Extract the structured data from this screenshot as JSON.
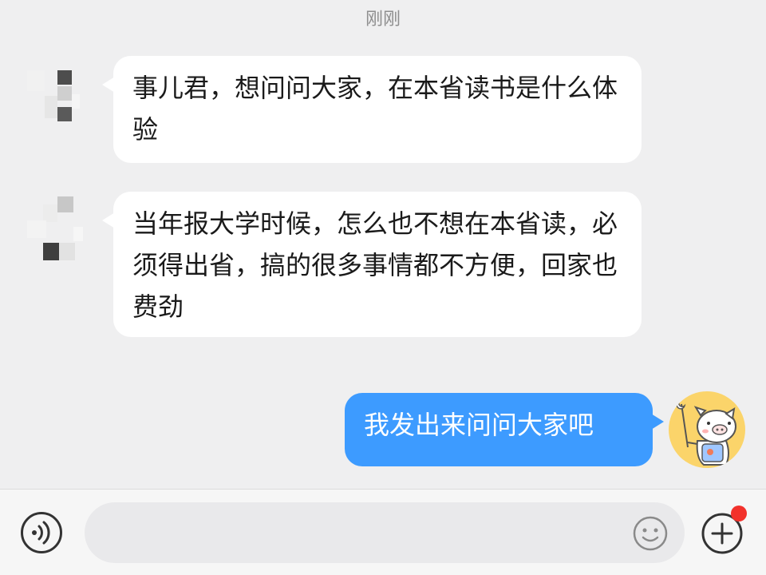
{
  "chat": {
    "timestamp": "刚刚",
    "messages": [
      {
        "side": "left",
        "text": "事儿君，想问问大家，在本省读书是什么体验"
      },
      {
        "side": "left",
        "text": "当年报大学时候，怎么也不想在本省读，必须得出省，搞的很多事情都不方便，回家也费劲"
      },
      {
        "side": "right",
        "text": "我发出来问问大家吧"
      }
    ]
  },
  "input_bar": {
    "text_value": "",
    "voice_icon": "voice-icon",
    "emoji_icon": "emoji-icon",
    "plus_icon": "plus-icon",
    "has_notification_dot": true
  },
  "colors": {
    "background": "#efeff0",
    "incoming_bubble": "#ffffff",
    "outgoing_bubble": "#3d9bff",
    "notification_dot": "#f2312b",
    "self_avatar_bg": "#fbd46a"
  }
}
